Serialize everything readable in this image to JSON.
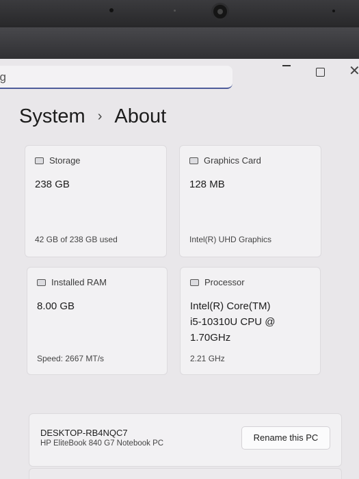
{
  "search": {
    "text": "ng"
  },
  "window_controls": {
    "close_glyph": "✕"
  },
  "breadcrumb": {
    "parent": "System",
    "separator": "›",
    "current": "About"
  },
  "cards": {
    "storage": {
      "title": "Storage",
      "value": "238 GB",
      "detail": "42 GB of 238 GB used",
      "icon": "storage-icon"
    },
    "graphics": {
      "title": "Graphics Card",
      "value": "128 MB",
      "detail": "Intel(R) UHD Graphics",
      "icon": "graphics-card-icon"
    },
    "ram": {
      "title": "Installed RAM",
      "value": "8.00 GB",
      "detail": "Speed: 2667 MT/s",
      "icon": "ram-icon"
    },
    "processor": {
      "title": "Processor",
      "value_lines": [
        "Intel(R) Core(TM)",
        "i5-10310U CPU @",
        "1.70GHz"
      ],
      "detail": "2.21 GHz",
      "icon": "processor-icon"
    }
  },
  "device": {
    "name": "DESKTOP-RB4NQC7",
    "model": "HP EliteBook 840 G7 Notebook PC",
    "rename_label": "Rename this PC"
  },
  "colors": {
    "accent_underline": "#4d5c9a",
    "card_bg": "#f2f1f3",
    "screen_bg": "#e9e7ea"
  }
}
